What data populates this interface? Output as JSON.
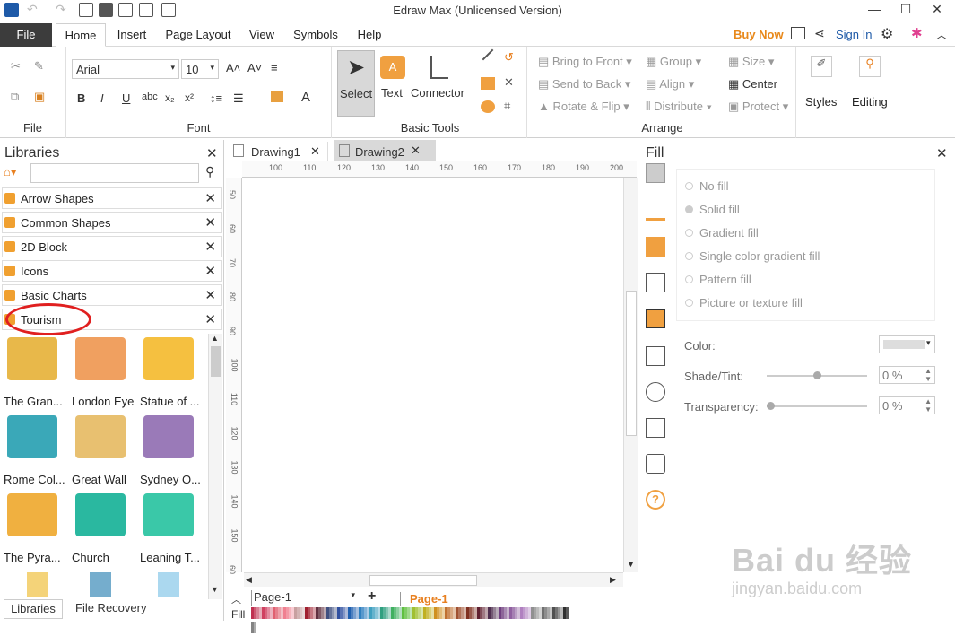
{
  "window": {
    "title": "Edraw Max (Unlicensed Version)"
  },
  "menu": {
    "file": "File",
    "tabs": [
      "Home",
      "Insert",
      "Page Layout",
      "View",
      "Symbols",
      "Help"
    ],
    "buy_now": "Buy Now",
    "sign_in": "Sign In"
  },
  "ribbon": {
    "file_group": "File",
    "font_group": "Font",
    "font_name": "Arial",
    "font_size": "10",
    "basic_tools_group": "Basic Tools",
    "select": "Select",
    "text": "Text",
    "connector": "Connector",
    "arrange_group": "Arrange",
    "bring_to_front": "Bring to Front",
    "send_to_back": "Send to Back",
    "rotate_flip": "Rotate & Flip",
    "group": "Group",
    "align": "Align",
    "distribute": "Distribute",
    "size": "Size",
    "center": "Center",
    "protect": "Protect",
    "styles": "Styles",
    "editing": "Editing"
  },
  "libraries": {
    "title": "Libraries",
    "items": [
      "Arrow Shapes",
      "Common Shapes",
      "2D Block",
      "Icons",
      "Basic Charts",
      "Tourism"
    ],
    "shapes": [
      {
        "label": "The Gran...",
        "color": "#e8b84a"
      },
      {
        "label": "London Eye",
        "color": "#f0a060"
      },
      {
        "label": "Statue of ...",
        "color": "#f5c040"
      },
      {
        "label": "Rome Col...",
        "color": "#3aa8b8"
      },
      {
        "label": "Great Wall",
        "color": "#e8c070"
      },
      {
        "label": "Sydney O...",
        "color": "#9a7ab8"
      },
      {
        "label": "The Pyra...",
        "color": "#f0b040"
      },
      {
        "label": "Church",
        "color": "#2ab8a0"
      },
      {
        "label": "Leaning T...",
        "color": "#3ac8a8"
      }
    ],
    "bottom_tabs": [
      "Libraries",
      "File Recovery"
    ]
  },
  "canvas": {
    "tabs": [
      "Drawing1",
      "Drawing2"
    ],
    "ruler_h": [
      "100",
      "110",
      "120",
      "130",
      "140",
      "150",
      "160",
      "170",
      "180",
      "190",
      "200"
    ],
    "ruler_v": [
      "50",
      "60",
      "70",
      "80",
      "90",
      "100",
      "110",
      "120",
      "130",
      "140",
      "150",
      "60"
    ],
    "page_select": "Page-1",
    "page_tab": "Page-1",
    "fill_label": "Fill"
  },
  "fill_panel": {
    "title": "Fill",
    "options": [
      "No fill",
      "Solid fill",
      "Gradient fill",
      "Single color gradient fill",
      "Pattern fill",
      "Picture or texture fill"
    ],
    "color_label": "Color:",
    "shade_label": "Shade/Tint:",
    "shade_value": "0 %",
    "transparency_label": "Transparency:",
    "transparency_value": "0 %"
  },
  "watermark": {
    "text": "Bai du 经验",
    "url": "jingyan.baidu.com"
  }
}
